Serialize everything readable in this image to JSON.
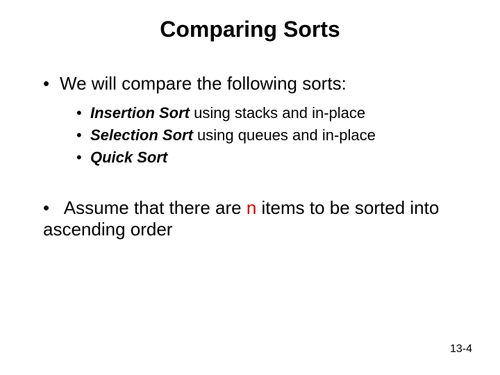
{
  "title": "Comparing Sorts",
  "intro": {
    "bullet": "•",
    "text": "We will compare the following sorts:"
  },
  "items": [
    {
      "bullet": "•",
      "bold": "Insertion Sort",
      "rest": " using stacks and in-place"
    },
    {
      "bullet": "•",
      "bold": "Selection Sort",
      "rest": " using queues and in-place"
    },
    {
      "bullet": "•",
      "bold": "Quick Sort",
      "rest": ""
    }
  ],
  "assume": {
    "bullet": "•",
    "before": " Assume that there are ",
    "n": "n",
    "after": " items to be sorted into ascending order"
  },
  "pageNumber": "13-4"
}
